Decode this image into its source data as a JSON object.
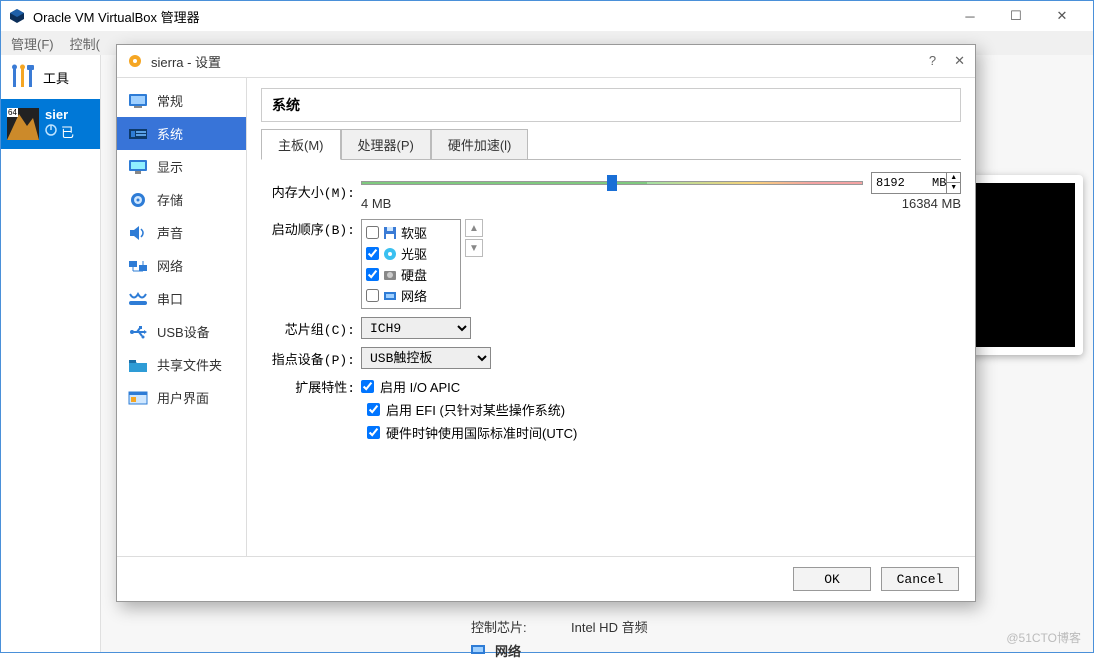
{
  "main": {
    "title": "Oracle VM VirtualBox 管理器",
    "menu": {
      "admin": "管理(F)",
      "ctrl": "控制("
    },
    "tools_label": "工具",
    "vm": {
      "thumb_tag": "64",
      "name": "sier",
      "state": "已"
    },
    "details": {
      "ctrl_chip_label": "控制芯片:",
      "ctrl_chip_value": "Intel HD 音频",
      "network_label": "网络"
    },
    "watermark": "@51CTO博客"
  },
  "dialog": {
    "title": "sierra - 设置",
    "help": "?",
    "categories": [
      {
        "key": "general",
        "label": "常规"
      },
      {
        "key": "system",
        "label": "系统"
      },
      {
        "key": "display",
        "label": "显示"
      },
      {
        "key": "storage",
        "label": "存储"
      },
      {
        "key": "audio",
        "label": "声音"
      },
      {
        "key": "network",
        "label": "网络"
      },
      {
        "key": "serial",
        "label": "串口"
      },
      {
        "key": "usb",
        "label": "USB设备"
      },
      {
        "key": "shared",
        "label": "共享文件夹"
      },
      {
        "key": "ui",
        "label": "用户界面"
      }
    ],
    "section_title": "系统",
    "tabs": [
      {
        "key": "mb",
        "label": "主板(M)",
        "active": true
      },
      {
        "key": "cpu",
        "label": "处理器(P)",
        "active": false
      },
      {
        "key": "accel",
        "label": "硬件加速(l)",
        "active": false
      }
    ],
    "memory": {
      "label": "内存大小(M):",
      "min": "4 MB",
      "max": "16384 MB",
      "value": "8192",
      "unit": "MB"
    },
    "boot": {
      "label": "启动顺序(B):",
      "items": [
        {
          "label": "软驱",
          "checked": false,
          "icon": "floppy"
        },
        {
          "label": "光驱",
          "checked": true,
          "icon": "disc"
        },
        {
          "label": "硬盘",
          "checked": true,
          "icon": "hdd"
        },
        {
          "label": "网络",
          "checked": false,
          "icon": "net"
        }
      ]
    },
    "chipset": {
      "label": "芯片组(C):",
      "value": "ICH9"
    },
    "pointer": {
      "label": "指点设备(P):",
      "value": "USB触控板"
    },
    "ext": {
      "label": "扩展特性:",
      "ioapic": "启用 I/O APIC",
      "efi": "启用 EFI (只针对某些操作系统)",
      "utc": "硬件时钟使用国际标准时间(UTC)"
    },
    "buttons": {
      "ok": "OK",
      "cancel": "Cancel"
    }
  }
}
